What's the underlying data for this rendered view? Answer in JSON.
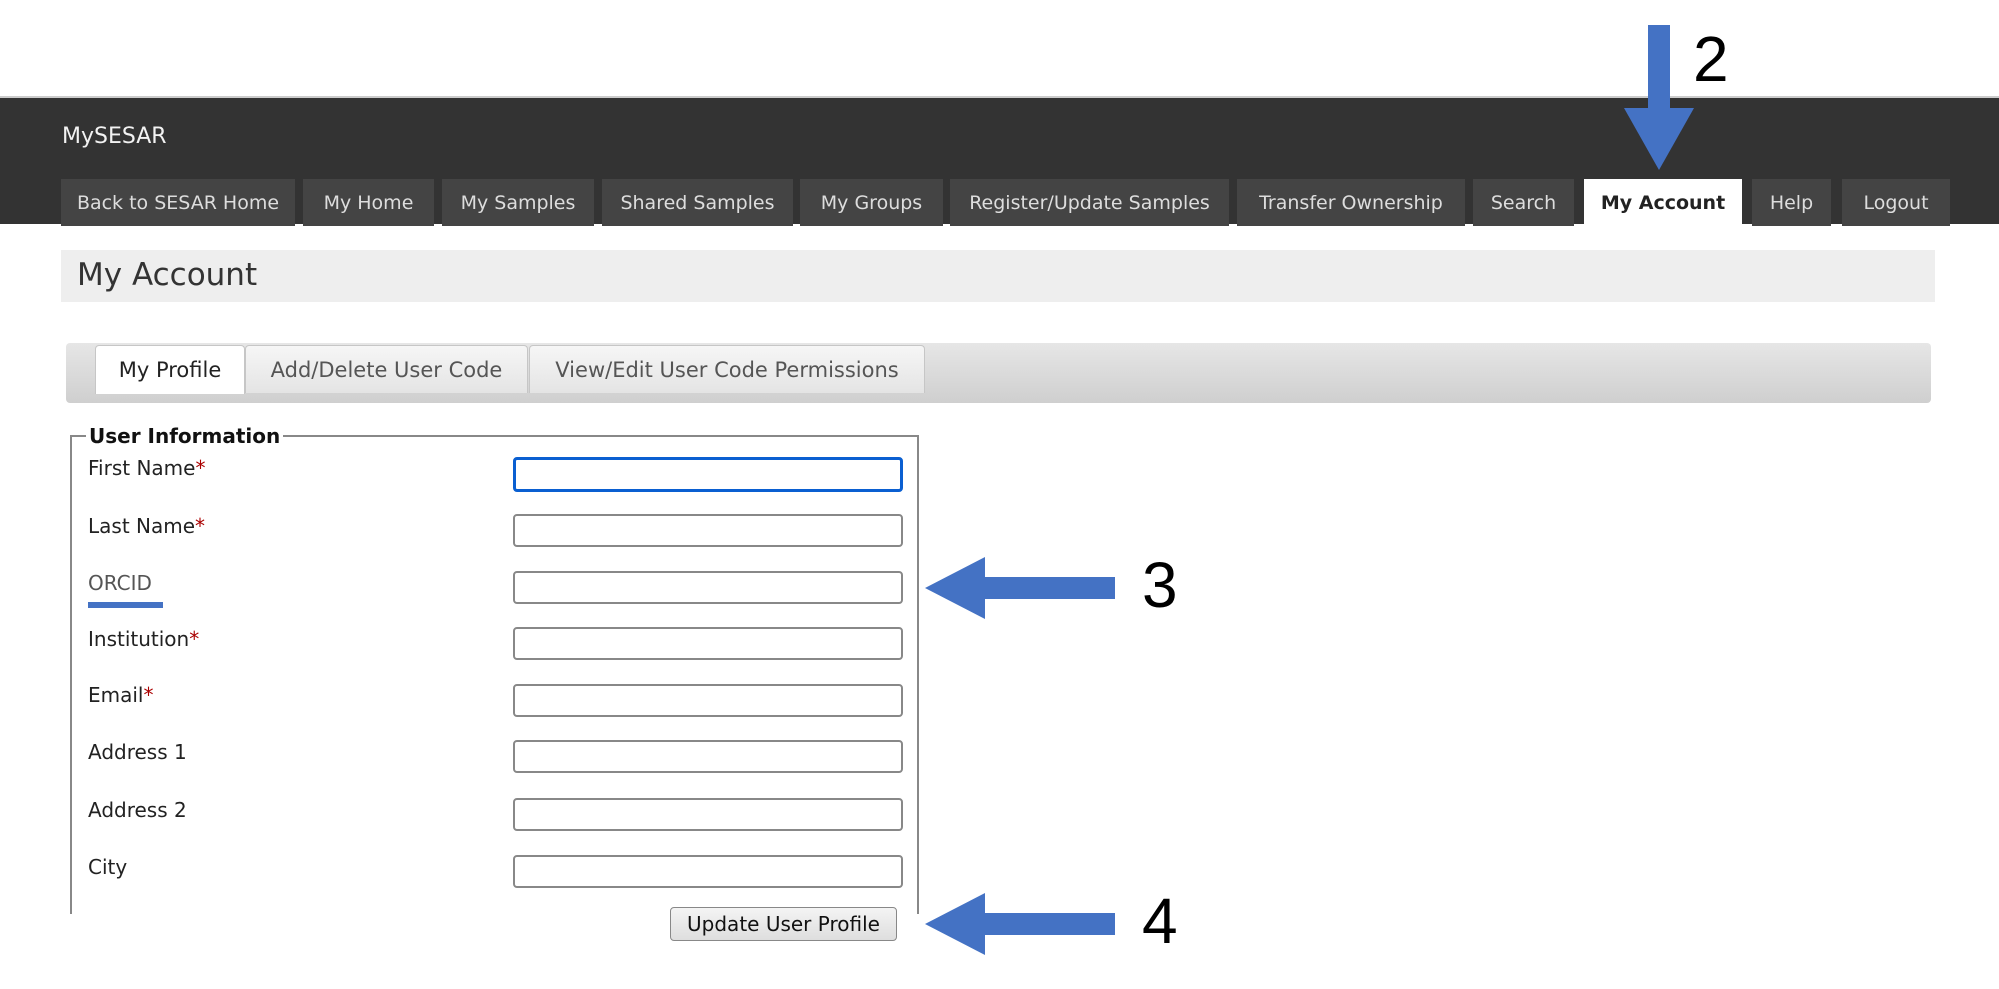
{
  "app": {
    "title": "MySESAR"
  },
  "nav": {
    "items": [
      {
        "label": "Back to SESAR Home",
        "active": false
      },
      {
        "label": "My Home",
        "active": false
      },
      {
        "label": "My Samples",
        "active": false
      },
      {
        "label": "Shared Samples",
        "active": false
      },
      {
        "label": "My Groups",
        "active": false
      },
      {
        "label": "Register/Update Samples",
        "active": false
      },
      {
        "label": "Transfer Ownership",
        "active": false
      },
      {
        "label": "Search",
        "active": false
      },
      {
        "label": "My Account",
        "active": true
      },
      {
        "label": "Help",
        "active": false
      },
      {
        "label": "Logout",
        "active": false
      }
    ]
  },
  "page": {
    "title": "My Account"
  },
  "subtabs": [
    {
      "label": "My Profile",
      "active": true
    },
    {
      "label": "Add/Delete User Code",
      "active": false
    },
    {
      "label": "View/Edit User Code Permissions",
      "active": false
    }
  ],
  "form": {
    "legend": "User Information",
    "required_marker": "*",
    "fields": [
      {
        "label": "First Name",
        "required": true,
        "value": "",
        "focused": true
      },
      {
        "label": "Last Name",
        "required": true,
        "value": ""
      },
      {
        "label": "ORCID",
        "required": false,
        "value": ""
      },
      {
        "label": "Institution",
        "required": true,
        "value": ""
      },
      {
        "label": "Email",
        "required": true,
        "value": ""
      },
      {
        "label": "Address 1",
        "required": false,
        "value": ""
      },
      {
        "label": "Address 2",
        "required": false,
        "value": ""
      },
      {
        "label": "City",
        "required": false,
        "value": ""
      }
    ],
    "submit_label": "Update User Profile"
  },
  "annotations": {
    "color": "#4472c4",
    "step2": "2",
    "step3": "3",
    "step4": "4"
  }
}
